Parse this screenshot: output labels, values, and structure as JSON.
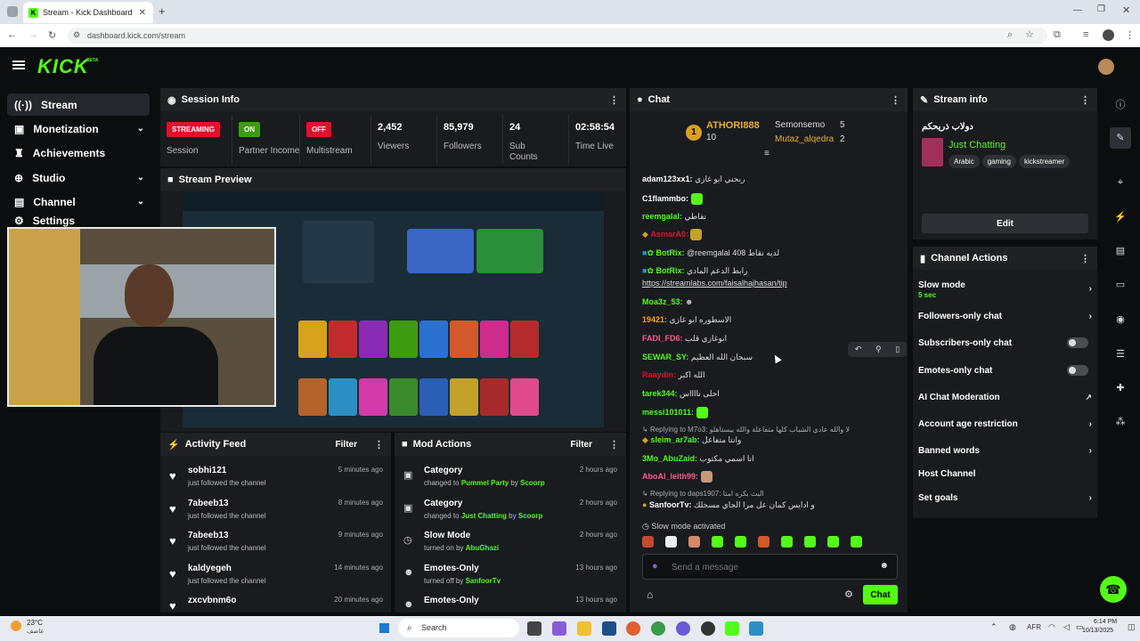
{
  "browser": {
    "tab_title": "Stream - Kick Dashboard",
    "url": "dashboard.kick.com/stream"
  },
  "header": {
    "logo": "KICK",
    "beta": "BETA"
  },
  "sidebar": {
    "items": [
      {
        "label": "Stream",
        "icon": "broadcast-icon"
      },
      {
        "label": "Monetization",
        "icon": "dollar-icon"
      },
      {
        "label": "Achievements",
        "icon": "trophy-icon"
      },
      {
        "label": "Studio",
        "icon": "studio-icon"
      },
      {
        "label": "Channel",
        "icon": "channel-icon"
      },
      {
        "label": "Settings",
        "icon": "gear-icon"
      }
    ]
  },
  "session": {
    "title": "Session Info",
    "cells": [
      {
        "value": "STREAMING",
        "label": "Session",
        "color": "#e0102c"
      },
      {
        "value": "ON",
        "label": "Partner Income",
        "color": "#3d9c10"
      },
      {
        "value": "OFF",
        "label": "Multistream",
        "color": "#e0102c"
      },
      {
        "value": "2,452",
        "label": "Viewers"
      },
      {
        "value": "85,979",
        "label": "Followers"
      },
      {
        "value": "24",
        "label": "Sub Counts"
      },
      {
        "value": "02:58:54",
        "label": "Time Live"
      }
    ]
  },
  "preview": {
    "title": "Stream Preview"
  },
  "activity": {
    "title": "Activity Feed",
    "filter": "Filter",
    "items": [
      {
        "name": "sobhi121",
        "sub": "just followed the channel",
        "time": "5 minutes ago"
      },
      {
        "name": "7abeeb13",
        "sub": "just followed the channel",
        "time": "8 minutes ago"
      },
      {
        "name": "7abeeb13",
        "sub": "just followed the channel",
        "time": "9 minutes ago"
      },
      {
        "name": "kaldyegeh",
        "sub": "just followed the channel",
        "time": "14 minutes ago"
      },
      {
        "name": "zxcvbnm6o",
        "sub": "",
        "time": "20 minutes ago"
      }
    ]
  },
  "mod": {
    "title": "Mod Actions",
    "filter": "Filter",
    "items": [
      {
        "name": "Category",
        "pre": "changed to",
        "hl": "Pummel Party",
        "by": "by",
        "user": "Scoorp",
        "time": "2 hours ago"
      },
      {
        "name": "Category",
        "pre": "changed to",
        "hl": "Just Chatting",
        "by": "by",
        "user": "Scoorp",
        "time": "2 hours ago"
      },
      {
        "name": "Slow Mode",
        "pre": "turned on by",
        "hl": "AbuGhazi",
        "by": "",
        "user": "",
        "time": "2 hours ago"
      },
      {
        "name": "Emotes-Only",
        "pre": "turned off by",
        "hl": "SanfoorTv",
        "by": "",
        "user": "",
        "time": "13 hours ago"
      },
      {
        "name": "Emotes-Only",
        "pre": "",
        "hl": "",
        "by": "",
        "user": "",
        "time": "13 hours ago"
      }
    ]
  },
  "chat": {
    "title": "Chat",
    "top": {
      "first": "ATHORI888",
      "first_count": "10",
      "second": "Semonsemo",
      "second_count": "5",
      "third": "Mutaz_alqedra",
      "third_count": "2",
      "rank": "1"
    },
    "messages": [
      {
        "user": "adam123xx1:",
        "text": "ربحني ابو غازي",
        "color": "#ffffff"
      },
      {
        "user": "C1flammbo:",
        "text": "",
        "color": "#ffffff"
      },
      {
        "user": "reemgalal:",
        "text": "نقاطي",
        "color": "#ffffff"
      },
      {
        "user": "AsmarA0:",
        "text": "",
        "color": "#e0102c"
      },
      {
        "user": "BotRix:",
        "text": "@reemgalal لديه نقاط 408",
        "color": "#ffffff"
      },
      {
        "user": "BotRix:",
        "text": "رابط الدعم المادي",
        "color": "#ffffff"
      },
      {
        "user": "",
        "text": "https://streamlabs.com/faisalhajhasan/tip",
        "color": "#ffffff"
      },
      {
        "user": "Moa3z_53:",
        "text": "",
        "color": "#ffffff"
      },
      {
        "user": "19421:",
        "text": "الاسطوره ابو غازي",
        "color": "#ff9c1a"
      },
      {
        "user": "FADI_FD6:",
        "text": "ابوغازي قلب",
        "color": "#ff5a8a"
      },
      {
        "user": "SEWAR_SY:",
        "text": "سبحان الله العظيم",
        "color": "#ffffff"
      },
      {
        "user": "Raaydin:",
        "text": "الله اكبر",
        "color": "#e0102c"
      },
      {
        "user": "tarek344:",
        "text": "احلى نااااس",
        "color": "#ffffff"
      },
      {
        "user": "messi101011:",
        "text": "",
        "color": "#ffffff"
      },
      {
        "user": "Replying to M7o3:",
        "text": "لا والله عادي الشباب كلها متفاعلة والله بيستاهلو",
        "color": "#aaaaaa"
      },
      {
        "user": "sleim_ar7ab:",
        "text": "وانتا متفاعل",
        "color": "#53fc18"
      },
      {
        "user": "3Mo_AbuZaid:",
        "text": "انا اسمي مكتوب",
        "color": "#53fc18"
      },
      {
        "user": "AboAl_leith99:",
        "text": "",
        "color": "#ff5a8a"
      },
      {
        "user": "Replying to daps1907:",
        "text": "البث بكره امتا",
        "color": "#aaaaaa"
      },
      {
        "user": "SanfoorTv:",
        "text": "و ادايس كمان عل مرا الجاي مسجلك",
        "color": "#ffffff"
      }
    ],
    "slow": "Slow mode activated",
    "placeholder": "Send a message",
    "send": "Chat"
  },
  "info": {
    "title": "Stream info",
    "stream_title": "دولاب ذريحكم",
    "category": "Just Chatting",
    "tags": [
      "Arabic",
      "gaming",
      "kickstreamer"
    ],
    "edit": "Edit"
  },
  "actions": {
    "title": "Channel Actions",
    "items": [
      {
        "label": "Slow mode",
        "sub": "5 sec",
        "type": "arrow"
      },
      {
        "label": "Followers-only chat",
        "type": "arrow"
      },
      {
        "label": "Subscribers-only chat",
        "type": "toggle"
      },
      {
        "label": "Emotes-only chat",
        "type": "toggle"
      },
      {
        "label": "AI Chat Moderation",
        "type": "ext"
      },
      {
        "label": "Account age restriction",
        "type": "arrow"
      },
      {
        "label": "Banned words",
        "type": "arrow"
      },
      {
        "label": "Host Channel",
        "type": "none"
      },
      {
        "label": "Set goals",
        "type": "arrow"
      }
    ]
  },
  "taskbar": {
    "weather": "23°C",
    "weather_sub": "عاصف",
    "search": "Search",
    "lang": "AFR",
    "time": "6:14 PM",
    "date": "10/13/2025"
  }
}
